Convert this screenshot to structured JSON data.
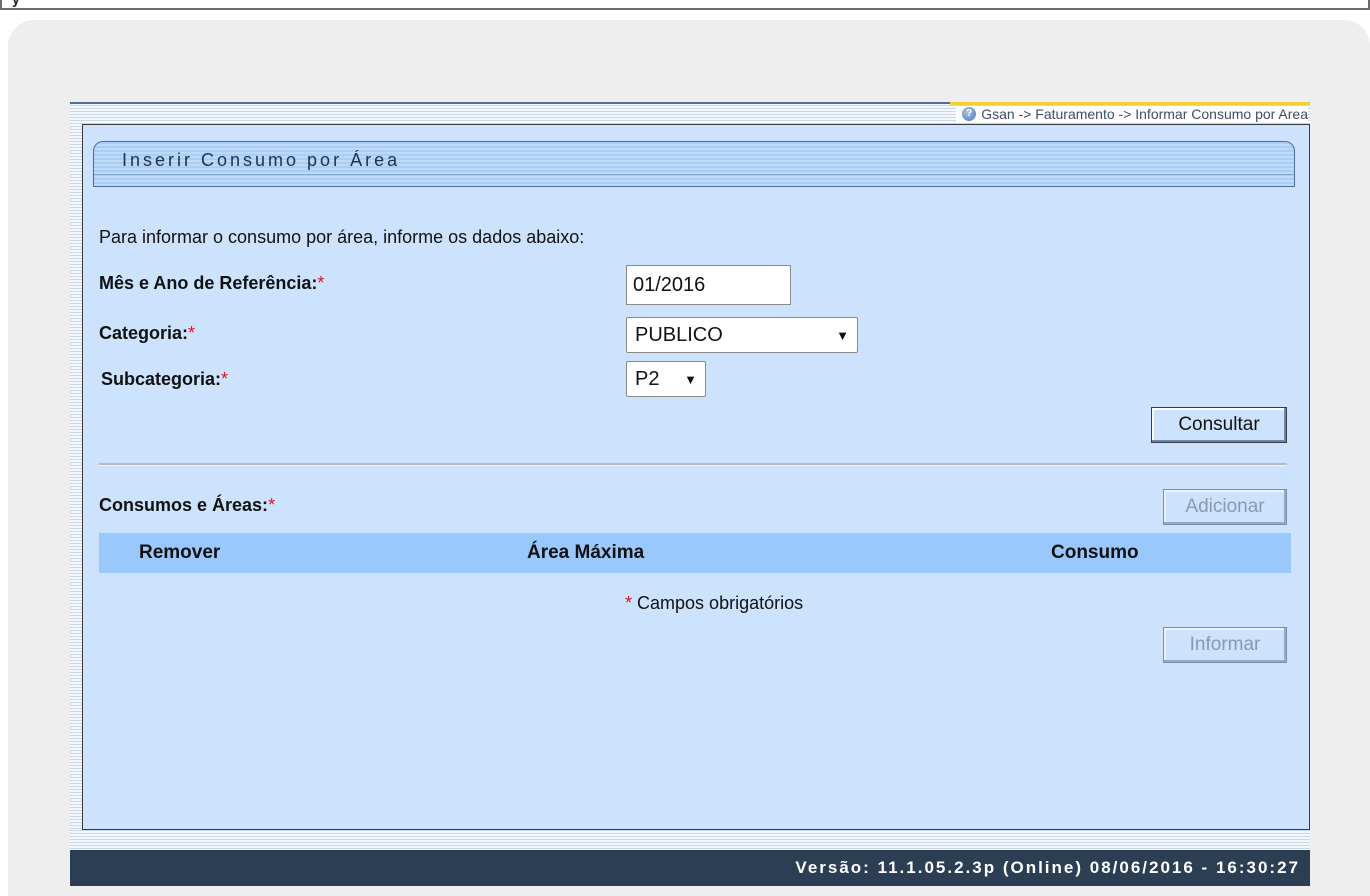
{
  "top_strip": {
    "glyph": "y"
  },
  "breadcrumb": {
    "text": "Gsan -> Faturamento -> Informar Consumo por Area"
  },
  "page": {
    "title": "Inserir Consumo por Área",
    "intro": "Para informar o consumo por área, informe os dados abaixo:"
  },
  "form": {
    "required_marker": "*",
    "reference": {
      "label": "Mês e Ano de Referência:",
      "value": "01/2016"
    },
    "categoria": {
      "label": "Categoria:",
      "selected": "PUBLICO"
    },
    "subcategoria": {
      "label": "Subcategoria:",
      "selected": "P2"
    },
    "consultar_label": "Consultar"
  },
  "consumos": {
    "label": "Consumos e Áreas:",
    "adicionar_label": "Adicionar",
    "columns": [
      "Remover",
      "Área Máxima",
      "Consumo"
    ]
  },
  "required_note": "Campos obrigatórios",
  "informar_label": "Informar",
  "footer": {
    "version": "Versão: 11.1.05.2.3p (Online) 08/06/2016 - 16:30:27"
  },
  "colors": {
    "panel_bg": "#cde3fd",
    "table_header_bg": "#99c8fc",
    "footer_bg": "#2c3e54",
    "required": "#e0161b"
  },
  "icons": {
    "help": "help-icon",
    "dropdown": "chevron-down-icon"
  }
}
